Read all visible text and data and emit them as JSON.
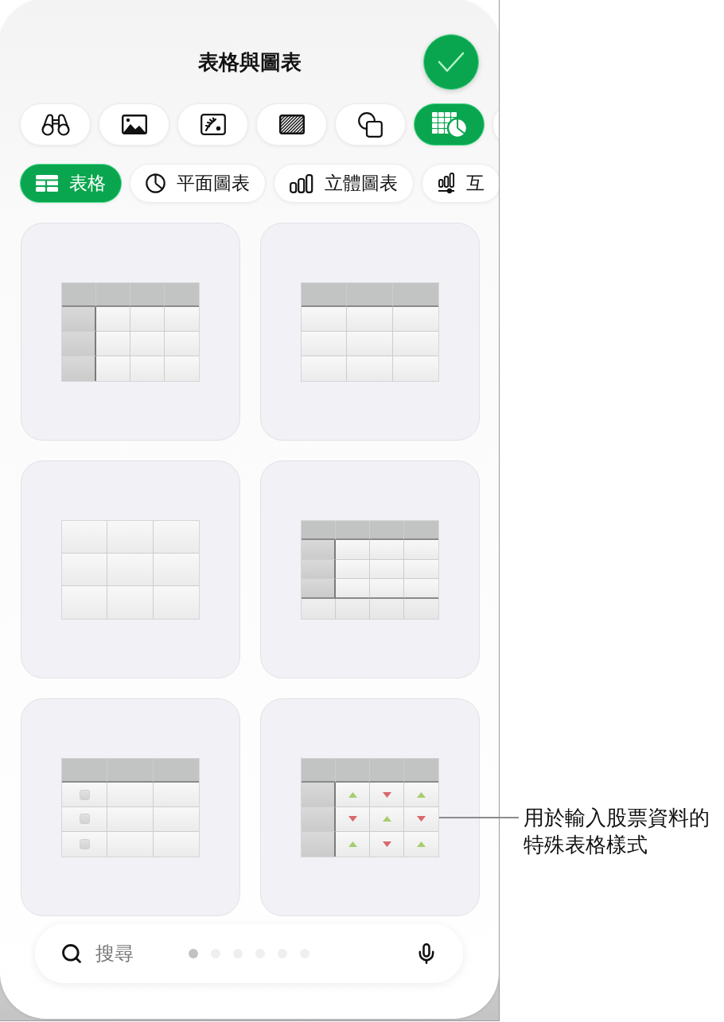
{
  "sheet": {
    "title": "表格與圖表"
  },
  "insert_tabs": [
    {
      "selected": false
    },
    {
      "selected": false
    },
    {
      "selected": false
    },
    {
      "selected": false
    },
    {
      "selected": false
    },
    {
      "selected": true
    },
    {
      "selected": false
    }
  ],
  "categories": [
    {
      "label": "表格",
      "selected": true
    },
    {
      "label": "平面圖表",
      "selected": false
    },
    {
      "label": "立體圖表",
      "selected": false
    },
    {
      "label": "互",
      "selected": false
    }
  ],
  "table_styles": [
    {
      "header_row": true,
      "header_column": true,
      "footer_row": false,
      "checkboxes": false
    },
    {
      "header_row": true,
      "header_column": false,
      "footer_row": false,
      "checkboxes": false
    },
    {
      "header_row": false,
      "header_column": false,
      "footer_row": false,
      "checkboxes": false
    },
    {
      "header_row": true,
      "header_column": true,
      "footer_row": true,
      "checkboxes": false
    },
    {
      "header_row": true,
      "header_column": false,
      "footer_row": false,
      "checkboxes": true
    },
    {
      "header_row": true,
      "header_column": true,
      "footer_row": false,
      "checkboxes": false,
      "markers": [
        [
          {
            "up": true
          },
          {
            "up": false
          },
          {
            "up": true
          }
        ],
        [
          {
            "up": false
          },
          {
            "up": true
          },
          {
            "up": false
          }
        ],
        [
          {
            "up": true
          },
          {
            "up": false
          },
          {
            "up": true
          }
        ]
      ]
    }
  ],
  "search": {
    "placeholder": "搜尋"
  },
  "page_dots": [
    {
      "selected": true
    },
    {
      "selected": false
    },
    {
      "selected": false
    },
    {
      "selected": false
    },
    {
      "selected": false
    },
    {
      "selected": false
    }
  ],
  "callout": {
    "text": "用於輸入股票資料的特殊表格樣式"
  }
}
